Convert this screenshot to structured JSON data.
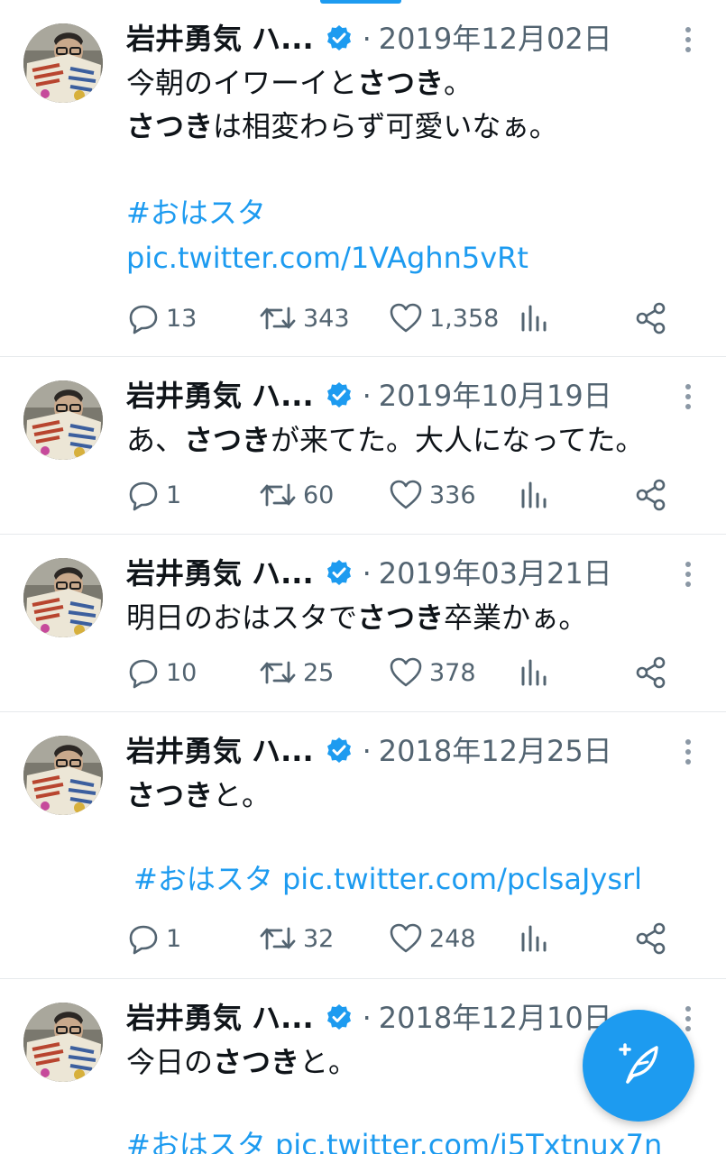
{
  "tweets": [
    {
      "name": "岩井勇気 ハ...",
      "separator": "·",
      "date": "2019年12月02日",
      "line1": [
        {
          "t": "今朝のイワーイと",
          "b": false
        },
        {
          "t": "さつき",
          "b": true
        },
        {
          "t": "。",
          "b": false
        }
      ],
      "line2": [
        {
          "t": "さつき",
          "b": true
        },
        {
          "t": "は相変わらず可愛いなぁ。",
          "b": false
        }
      ],
      "hashtag": "#おはスタ",
      "link": "pic.twitter.com/1VAghn5vRt",
      "replies": "13",
      "retweets": "343",
      "likes": "1,358"
    },
    {
      "name": "岩井勇気 ハ...",
      "separator": "·",
      "date": "2019年10月19日",
      "line1": [
        {
          "t": "あ、",
          "b": false
        },
        {
          "t": "さつき",
          "b": true
        },
        {
          "t": "が来てた。大人になってた。",
          "b": false
        }
      ],
      "replies": "1",
      "retweets": "60",
      "likes": "336"
    },
    {
      "name": "岩井勇気 ハ...",
      "separator": "·",
      "date": "2019年03月21日",
      "line1": [
        {
          "t": "明日のおはスタで",
          "b": false
        },
        {
          "t": "さつき",
          "b": true
        },
        {
          "t": "卒業かぁ。",
          "b": false
        }
      ],
      "replies": "10",
      "retweets": "25",
      "likes": "378"
    },
    {
      "name": "岩井勇気 ハ...",
      "separator": "·",
      "date": "2018年12月25日",
      "line1": [
        {
          "t": "さつき",
          "b": true
        },
        {
          "t": "と。",
          "b": false
        }
      ],
      "link_line": "#おはスタ pic.twitter.com/pclsaJysrl",
      "replies": "1",
      "retweets": "32",
      "likes": "248"
    },
    {
      "name": "岩井勇気 ハ...",
      "separator": "·",
      "date": "2018年12月10日",
      "line1": [
        {
          "t": "今日の",
          "b": false
        },
        {
          "t": "さつき",
          "b": true
        },
        {
          "t": "と。",
          "b": false
        }
      ],
      "link_line": "#おはスタ pic.twitter.com/i5Txtnux7n"
    }
  ],
  "colors": {
    "accent": "#1d9bf0",
    "muted": "#536471",
    "text": "#0f1419"
  },
  "icons": [
    "verified-badge-icon",
    "more-vertical-icon",
    "reply-icon",
    "retweet-icon",
    "like-icon",
    "views-icon",
    "share-icon",
    "compose-tweet-icon"
  ]
}
